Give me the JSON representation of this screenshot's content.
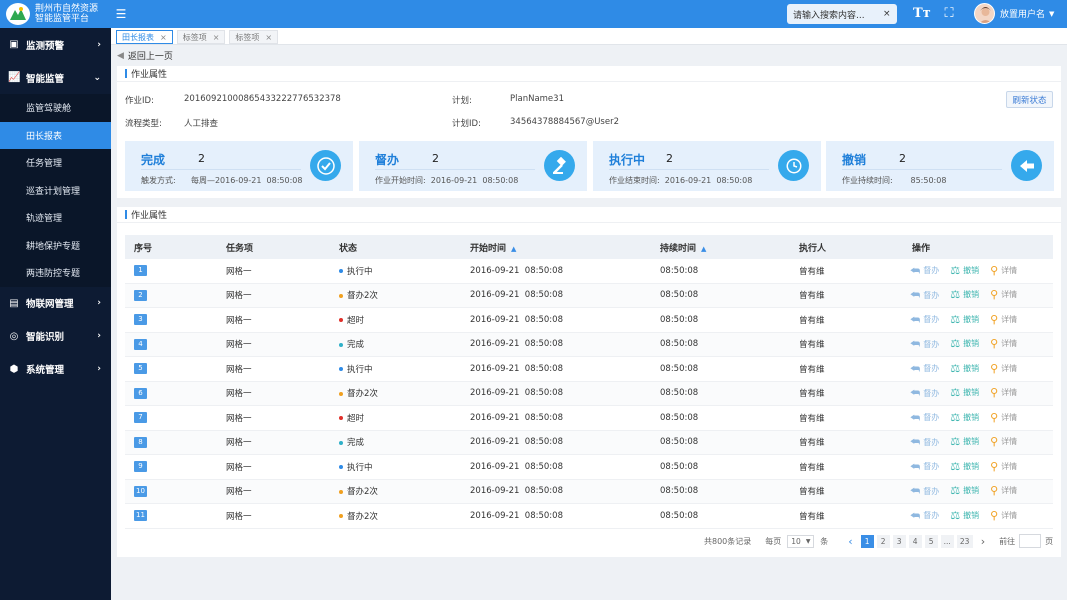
{
  "brand": {
    "line1": "荆州市自然资源",
    "line2": "智能监管平台"
  },
  "header": {
    "search_value": "请输入搜索内容...",
    "search_clear": "×",
    "font_icon": "Tт",
    "fullscreen_icon": "⛶",
    "user_name": "放置用户名",
    "user_caret": "▼"
  },
  "sidebar": {
    "groups": [
      {
        "label": "监测预警",
        "icon": "monitor-icon",
        "chev": "›"
      },
      {
        "label": "智能监管",
        "icon": "chart-icon",
        "chev": "⌄"
      },
      {
        "label": "物联网管理",
        "icon": "iot-icon",
        "chev": "›"
      },
      {
        "label": "智能识别",
        "icon": "recognize-icon",
        "chev": "›"
      },
      {
        "label": "系统管理",
        "icon": "settings-icon",
        "chev": "›"
      }
    ],
    "subs": [
      "监管驾驶舱",
      "田长报表",
      "任务管理",
      "巡查计划管理",
      "轨迹管理",
      "耕地保护专题",
      "两违防控专题"
    ]
  },
  "tabs": [
    {
      "label": "田长报表",
      "close": "×"
    },
    {
      "label": "标签项",
      "close": "×"
    },
    {
      "label": "标签项",
      "close": "×"
    }
  ],
  "back_label": "返回上一页",
  "props": {
    "title": "作业属性",
    "job_id_label": "作业ID:",
    "job_id": "20160921000865433222776532378",
    "plan_label": "计划:",
    "plan": "PlanName31",
    "flow_label": "流程类型:",
    "flow": "人工排查",
    "plan_id_label": "计划ID:",
    "plan_id": "34564378884567@User2",
    "refresh": "刷新状态"
  },
  "stats": [
    {
      "title": "完成",
      "num": "2",
      "desc": "触发方式:      每周—2016-09-21  08:50:08",
      "icon": "check-icon"
    },
    {
      "title": "督办",
      "num": "2",
      "desc": "作业开始时间:  2016-09-21  08:50:08",
      "icon": "gavel-icon"
    },
    {
      "title": "执行中",
      "num": "2",
      "desc": "作业结束时间:  2016-09-21  08:50:08",
      "icon": "clock-icon"
    },
    {
      "title": "撤销",
      "num": "2",
      "desc": "作业持续时间:       85:50:08",
      "icon": "undo-icon"
    }
  ],
  "table": {
    "title": "作业属性",
    "headers": [
      "序号",
      "任务项",
      "状态",
      "开始时间",
      "持续时间",
      "执行人",
      "操作"
    ],
    "sort_icon": "▲",
    "actions": [
      "督办",
      "撤销",
      "详情"
    ],
    "status_colors": {
      "执行中": "#2f8be6",
      "督办2次": "#f0a020",
      "超时": "#e0302a",
      "完成": "#2fb0c8"
    },
    "rows": [
      {
        "idx": "1",
        "task": "网格一",
        "status": "执行中",
        "start": "2016-09-21  08:50:08",
        "dur": "08:50:08",
        "exec": "曾有维"
      },
      {
        "idx": "2",
        "task": "网格一",
        "status": "督办2次",
        "start": "2016-09-21  08:50:08",
        "dur": "08:50:08",
        "exec": "曾有维"
      },
      {
        "idx": "3",
        "task": "网格一",
        "status": "超时",
        "start": "2016-09-21  08:50:08",
        "dur": "08:50:08",
        "exec": "曾有维"
      },
      {
        "idx": "4",
        "task": "网格一",
        "status": "完成",
        "start": "2016-09-21  08:50:08",
        "dur": "08:50:08",
        "exec": "曾有维"
      },
      {
        "idx": "5",
        "task": "网格一",
        "status": "执行中",
        "start": "2016-09-21  08:50:08",
        "dur": "08:50:08",
        "exec": "曾有维"
      },
      {
        "idx": "6",
        "task": "网格一",
        "status": "督办2次",
        "start": "2016-09-21  08:50:08",
        "dur": "08:50:08",
        "exec": "曾有维"
      },
      {
        "idx": "7",
        "task": "网格一",
        "status": "超时",
        "start": "2016-09-21  08:50:08",
        "dur": "08:50:08",
        "exec": "曾有维"
      },
      {
        "idx": "8",
        "task": "网格一",
        "status": "完成",
        "start": "2016-09-21  08:50:08",
        "dur": "08:50:08",
        "exec": "曾有维"
      },
      {
        "idx": "9",
        "task": "网格一",
        "status": "执行中",
        "start": "2016-09-21  08:50:08",
        "dur": "08:50:08",
        "exec": "曾有维"
      },
      {
        "idx": "10",
        "task": "网格一",
        "status": "督办2次",
        "start": "2016-09-21  08:50:08",
        "dur": "08:50:08",
        "exec": "曾有维"
      },
      {
        "idx": "11",
        "task": "网格一",
        "status": "督办2次",
        "start": "2016-09-21  08:50:08",
        "dur": "08:50:08",
        "exec": "曾有维"
      }
    ]
  },
  "pager": {
    "total": "共800条记录",
    "per_label": "每页",
    "per_value": "10",
    "per_unit": "条",
    "pages": [
      "1",
      "2",
      "3",
      "4",
      "5",
      "...",
      "23"
    ],
    "active": "1",
    "goto_label": "前往",
    "goto_unit": "页",
    "prev": "‹",
    "next": "›"
  }
}
